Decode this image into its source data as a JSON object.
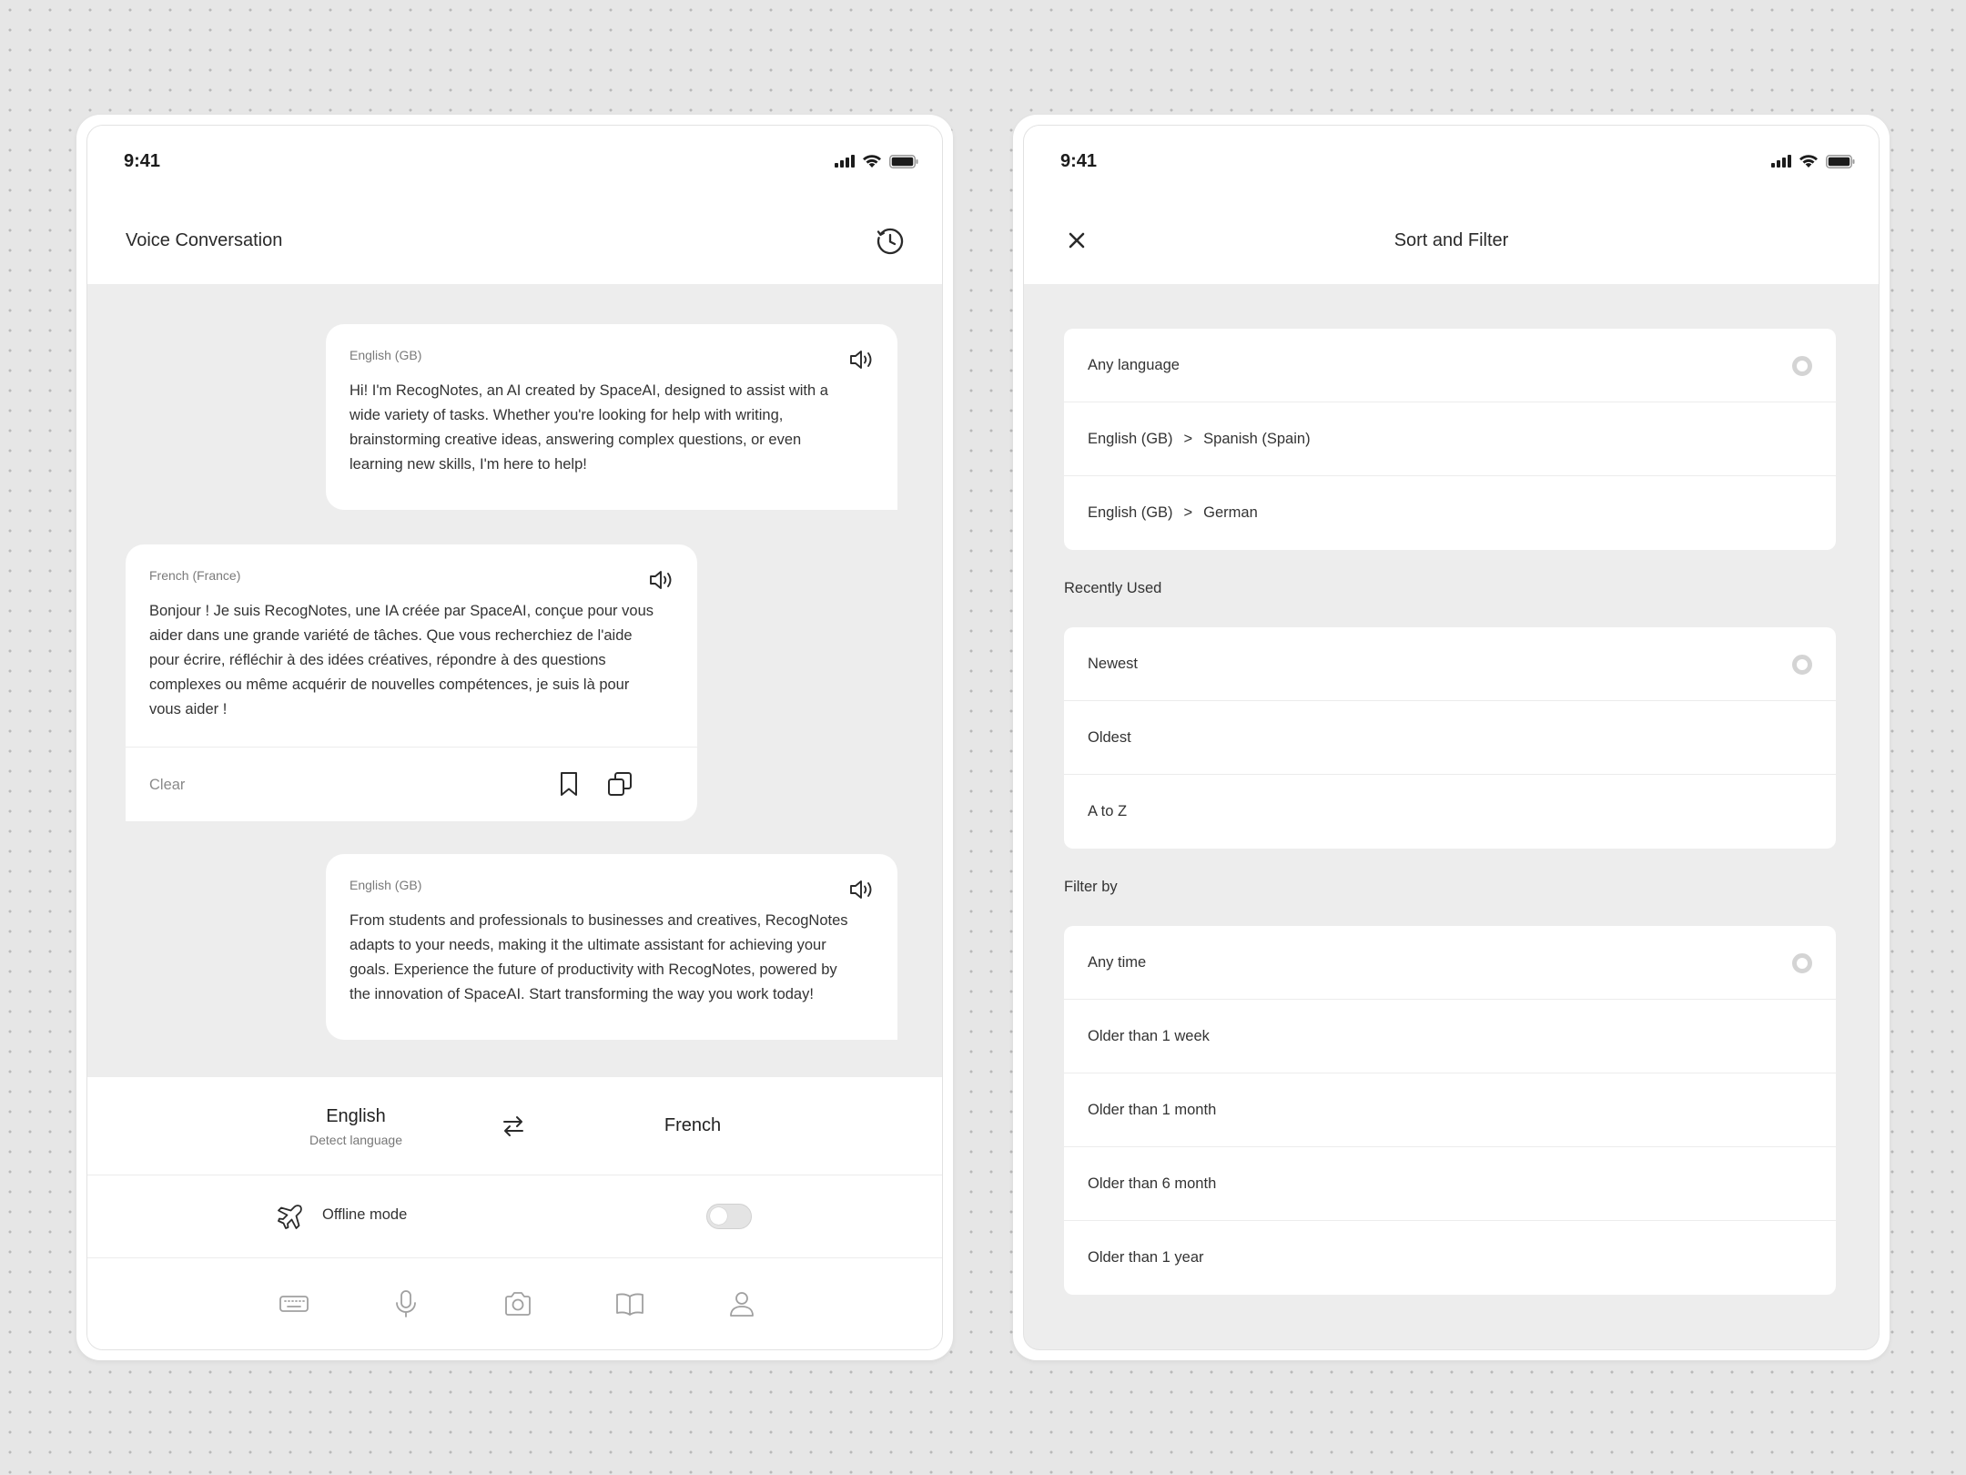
{
  "left": {
    "status": {
      "time": "9:41"
    },
    "header": {
      "title": "Voice Conversation"
    },
    "messages": [
      {
        "lang": "English (GB)",
        "lines": [
          "Hi! I'm RecogNotes, an AI created by SpaceAI, designed to assist with a",
          "wide variety of tasks. Whether you're looking for help with writing,",
          "brainstorming creative ideas, answering complex questions, or even",
          "learning new skills, I'm here to help!"
        ]
      },
      {
        "lang": "French (France)",
        "lines": [
          "Bonjour ! Je suis RecogNotes, une IA créée par SpaceAI, conçue pour vous",
          "aider dans une grande variété de tâches. Que vous recherchiez de l'aide",
          "pour écrire, réfléchir à des idées créatives, répondre à des questions",
          "complexes ou même acquérir de nouvelles compétences, je suis là pour",
          "vous aider !"
        ],
        "clear_label": "Clear"
      },
      {
        "lang": "English (GB)",
        "lines": [
          "From students and professionals to businesses and creatives, RecogNotes",
          "adapts to your needs, making it the ultimate assistant for achieving your",
          "goals. Experience the future of productivity with RecogNotes, powered by",
          "the innovation of SpaceAI. Start transforming the way you work today!"
        ]
      }
    ],
    "languages": {
      "source": "English",
      "source_sub": "Detect language",
      "target": "French"
    },
    "offline": {
      "label": "Offline mode",
      "enabled": false
    },
    "tabs": [
      "keyboard-icon",
      "microphone-icon",
      "camera-icon",
      "book-icon",
      "profile-icon"
    ]
  },
  "right": {
    "status": {
      "time": "9:41"
    },
    "header": {
      "title": "Sort and Filter"
    },
    "languages": [
      {
        "label": "Any language"
      },
      {
        "from": "English (GB)",
        "arrow": ">",
        "to": "Spanish (Spain)"
      },
      {
        "from": "English (GB)",
        "arrow": ">",
        "to": "German"
      }
    ],
    "recently_used": {
      "label": "Recently Used",
      "items": [
        "Newest",
        "Oldest",
        "A to Z"
      ]
    },
    "filter_by": {
      "label": "Filter by",
      "items": [
        "Any time",
        "Older than 1 week",
        "Older than 1 month",
        "Older than 6 month",
        "Older than 1 year"
      ]
    }
  }
}
